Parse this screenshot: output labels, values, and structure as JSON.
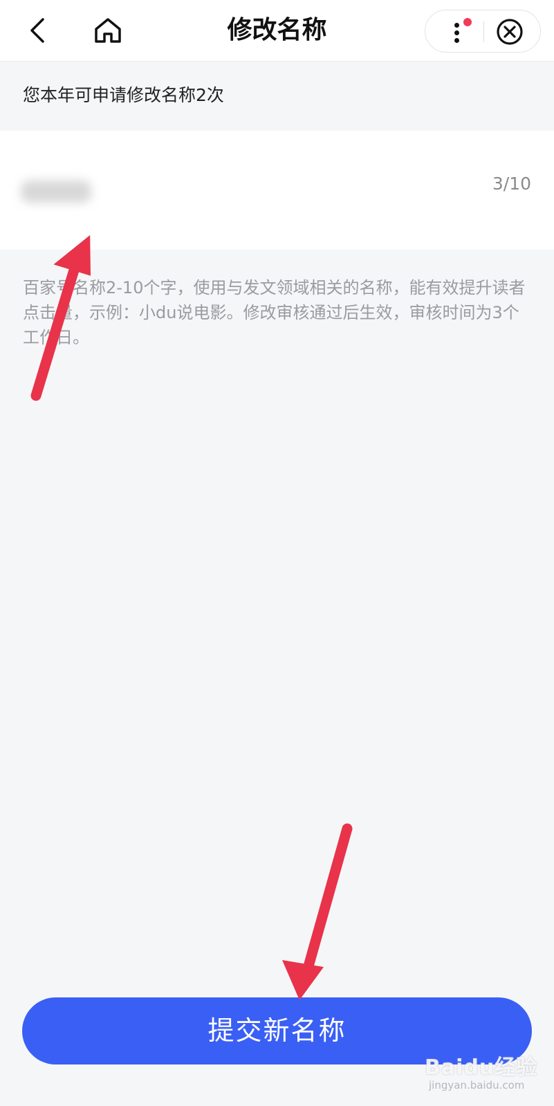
{
  "header": {
    "title": "修改名称",
    "back_icon": "chevron-left-icon",
    "home_icon": "home-icon",
    "more_icon": "more-vertical-icon",
    "close_icon": "close-circle-icon",
    "notify_color": "#f23a59"
  },
  "quota": {
    "text": "您本年可申请修改名称2次"
  },
  "name_input": {
    "count": "3/10"
  },
  "hint": {
    "text": "百家号名称2-10个字，使用与发文领域相关的名称，能有效提升读者点击量，示例：小du说电影。修改审核通过后生效，审核时间为3个工作日。"
  },
  "submit": {
    "label": "提交新名称",
    "color": "#3a5ff5"
  },
  "annotation": {
    "arrow_color": "#e8334a"
  },
  "watermark": {
    "brand": "Baidu经验",
    "domain": "jingyan.baidu.com"
  }
}
